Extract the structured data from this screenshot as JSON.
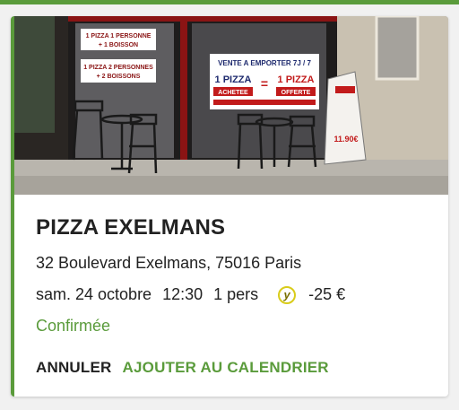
{
  "colors": {
    "accent": "#5a9b3b",
    "text": "#222222",
    "badge": "#d9cc1a"
  },
  "photo": {
    "window_sign_1": [
      "1 PIZZA 1 PERSONNE",
      "+ 1 BOISSON"
    ],
    "window_sign_2": [
      "1 PIZZA 2 PERSONNES",
      "+ 2 BOISSONS"
    ],
    "banner_top": "VENTE A EMPORTER 7J / 7",
    "banner_left": [
      "1 PIZZA",
      "ACHETEE"
    ],
    "banner_eq": "=",
    "banner_right": [
      "1 PIZZA",
      "OFFERTE"
    ],
    "board_price": "11.90€"
  },
  "restaurant": {
    "name": "PIZZA EXELMANS",
    "address": "32 Boulevard Exelmans, 75016 Paris"
  },
  "booking": {
    "date": "sam. 24 octobre",
    "time": "12:30",
    "people": "1 pers",
    "badge_icon": "yums-y-icon",
    "badge_letter": "y",
    "discount": "-25 €",
    "status": "Confirmée"
  },
  "actions": {
    "cancel_label": "ANNULER",
    "calendar_label": "AJOUTER AU CALENDRIER"
  }
}
